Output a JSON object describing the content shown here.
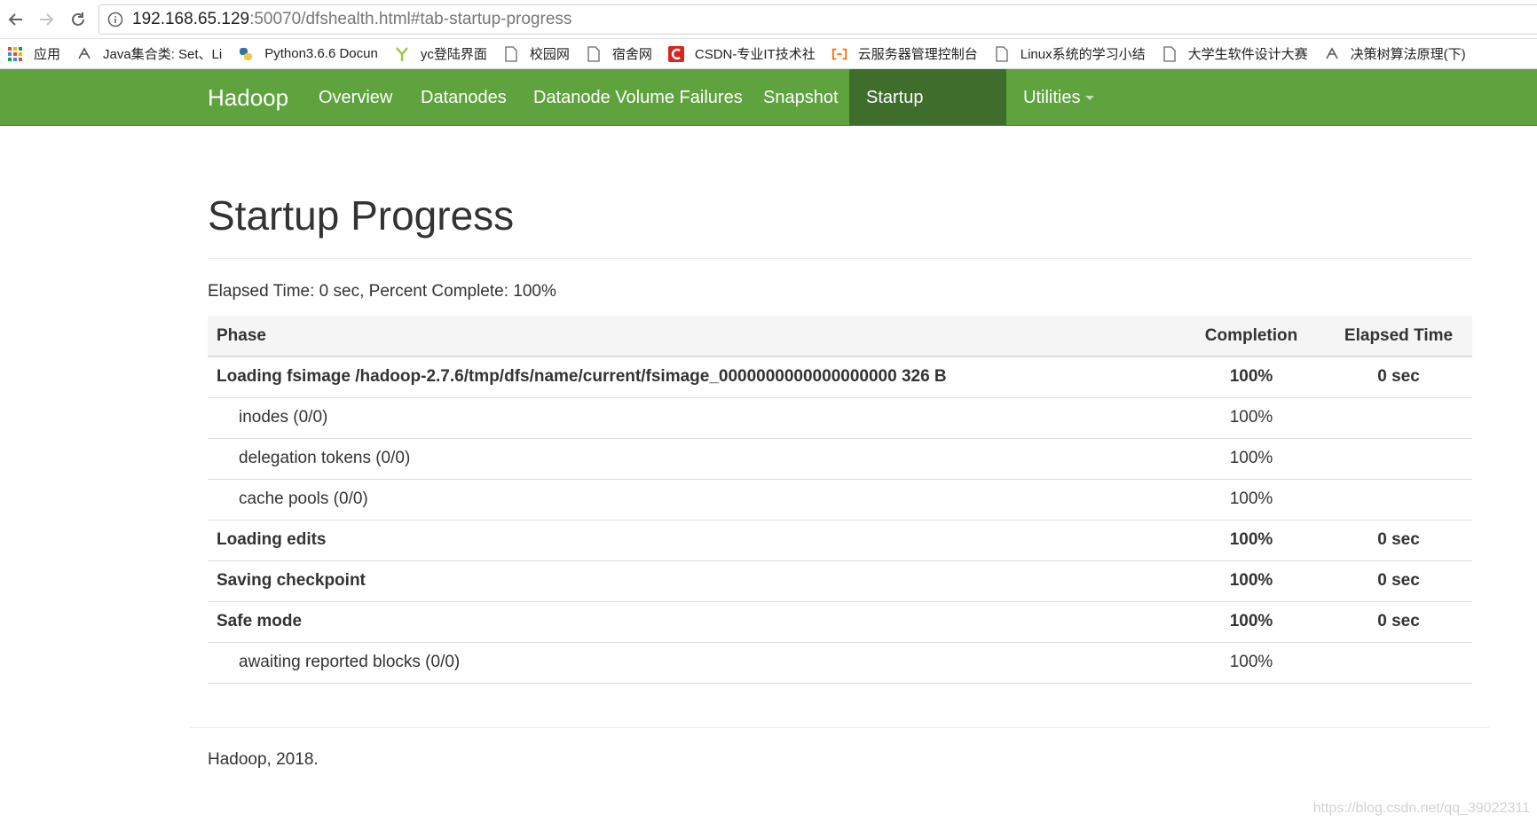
{
  "browser": {
    "url_host": "192.168.65.129",
    "url_rest": ":50070/dfshealth.html#tab-startup-progress"
  },
  "bookmarks": [
    {
      "label": "应用",
      "icon": "apps-grid-icon"
    },
    {
      "label": "Java集合类: Set、Li",
      "icon": "bookmark-favicon-icon"
    },
    {
      "label": "Python3.6.6 Docun",
      "icon": "python-icon"
    },
    {
      "label": "yc登陆界面",
      "icon": "y-icon"
    },
    {
      "label": "校园网",
      "icon": "page-icon"
    },
    {
      "label": "宿舍网",
      "icon": "page-icon"
    },
    {
      "label": "CSDN-专业IT技术社",
      "icon": "csdn-icon"
    },
    {
      "label": "云服务器管理控制台",
      "icon": "aliyun-icon"
    },
    {
      "label": "Linux系统的学习小结",
      "icon": "page-icon"
    },
    {
      "label": "大学生软件设计大赛",
      "icon": "page-icon"
    },
    {
      "label": "决策树算法原理(下)",
      "icon": "bookmark-favicon-icon"
    }
  ],
  "navbar": {
    "brand": "Hadoop",
    "items": [
      {
        "label": "Overview"
      },
      {
        "label": "Datanodes"
      },
      {
        "label": "Datanode Volume Failures"
      },
      {
        "label": "Snapshot"
      },
      {
        "label": "Startup Progress",
        "active": true
      },
      {
        "label": "Utilities",
        "dropdown": true
      }
    ]
  },
  "page": {
    "title": "Startup Progress",
    "summary": "Elapsed Time: 0 sec, Percent Complete: 100%"
  },
  "table": {
    "headers": {
      "phase": "Phase",
      "completion": "Completion",
      "elapsed": "Elapsed Time"
    },
    "rows": [
      {
        "kind": "phase",
        "phase": "Loading fsimage /hadoop-2.7.6/tmp/dfs/name/current/fsimage_0000000000000000000 326 B",
        "completion": "100%",
        "elapsed": "0 sec"
      },
      {
        "kind": "step",
        "phase": "inodes (0/0)",
        "completion": "100%",
        "elapsed": ""
      },
      {
        "kind": "step",
        "phase": "delegation tokens (0/0)",
        "completion": "100%",
        "elapsed": ""
      },
      {
        "kind": "step",
        "phase": "cache pools (0/0)",
        "completion": "100%",
        "elapsed": ""
      },
      {
        "kind": "phase",
        "phase": "Loading edits",
        "completion": "100%",
        "elapsed": "0 sec"
      },
      {
        "kind": "phase",
        "phase": "Saving checkpoint",
        "completion": "100%",
        "elapsed": "0 sec"
      },
      {
        "kind": "phase",
        "phase": "Safe mode",
        "completion": "100%",
        "elapsed": "0 sec"
      },
      {
        "kind": "step",
        "phase": "awaiting reported blocks (0/0)",
        "completion": "100%",
        "elapsed": ""
      }
    ]
  },
  "footer": {
    "text": "Hadoop, 2018."
  },
  "watermark": "https://blog.csdn.net/qq_39022311",
  "colors": {
    "navbar": "#5fa33e",
    "navbar_active": "#3f6d2c"
  }
}
